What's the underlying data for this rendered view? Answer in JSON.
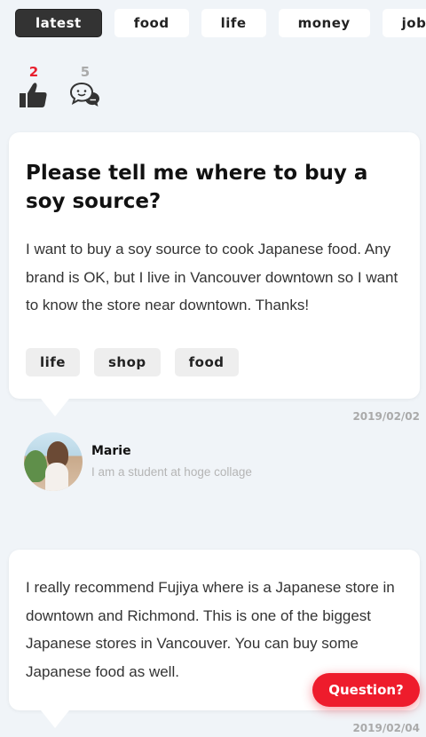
{
  "tabs": [
    {
      "label": "latest",
      "active": true
    },
    {
      "label": "food",
      "active": false
    },
    {
      "label": "life",
      "active": false
    },
    {
      "label": "money",
      "active": false
    },
    {
      "label": "job",
      "active": false
    }
  ],
  "stats": {
    "likes": {
      "count": "2",
      "icon": "thumbs-up-icon",
      "color": "#e8202e"
    },
    "comments": {
      "count": "5",
      "icon": "chat-bubbles-icon",
      "color": "#aaaaaa"
    }
  },
  "question": {
    "title": "Please tell me where to buy a soy source?",
    "body": "I want to buy a soy source to cook Japanese food. Any brand is OK, but I live in Vancouver downtown so I want to know the store near downtown. Thanks!",
    "tags": [
      "life",
      "shop",
      "food"
    ],
    "date": "2019/02/02"
  },
  "author": {
    "name": "Marie",
    "bio": "I am a student at hoge collage"
  },
  "answer": {
    "body": "I really recommend Fujiya where is a Japanese store in downtown and Richmond. This is one of the biggest Japanese stores in Vancouver. You can buy some Japanese food as well.",
    "date": "2019/02/04"
  },
  "fab": {
    "label": "Question?",
    "color": "#ee1c2c"
  }
}
